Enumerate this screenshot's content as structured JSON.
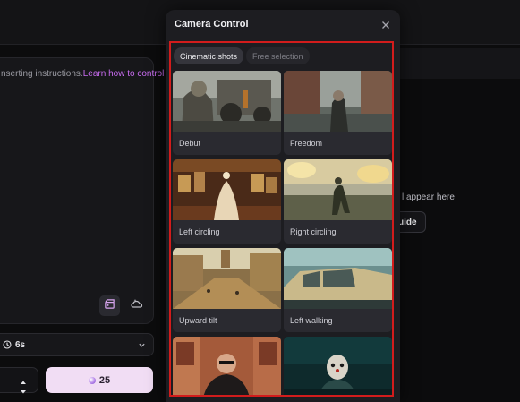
{
  "background": {
    "instruction_text": "nserting instructions.",
    "learn_link": "Learn how to control",
    "appear_text": "l appear here",
    "guide_label": "uide",
    "duration_label": "6s",
    "generate_cost": "25"
  },
  "modal": {
    "title": "Camera Control",
    "tabs": [
      {
        "label": "Cinematic shots",
        "active": true
      },
      {
        "label": "Free selection",
        "active": false
      }
    ],
    "cards": [
      {
        "label": "Debut",
        "icon": "soldier-scene-thumbnail"
      },
      {
        "label": "Freedom",
        "icon": "street-walker-thumbnail"
      },
      {
        "label": "Left circling",
        "icon": "gown-gallery-thumbnail"
      },
      {
        "label": "Right circling",
        "icon": "battlefield-soldier-thumbnail"
      },
      {
        "label": "Upward tilt",
        "icon": "old-town-street-thumbnail"
      },
      {
        "label": "Left walking",
        "icon": "vintage-car-thumbnail"
      },
      {
        "label": "",
        "icon": "woman-sunglasses-thumbnail"
      },
      {
        "label": "",
        "icon": "clown-thumbnail"
      }
    ]
  },
  "colors": {
    "highlight": "#d21c1c",
    "accent_link": "#c86cf0",
    "generate_bg": "#f1ddf4"
  }
}
